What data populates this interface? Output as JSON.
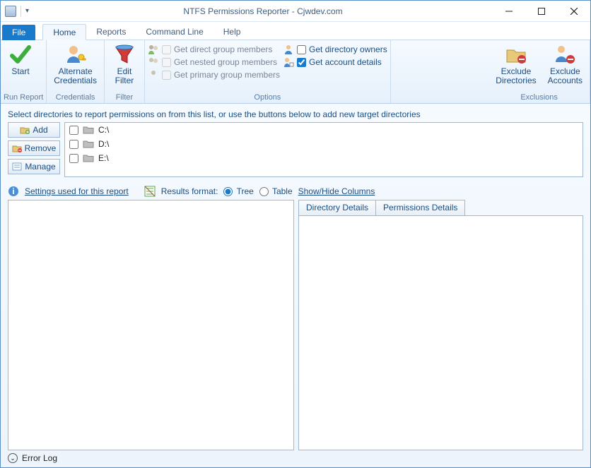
{
  "title": "NTFS Permissions Reporter - Cjwdev.com",
  "tabs": {
    "file": "File",
    "home": "Home",
    "reports": "Reports",
    "cmdline": "Command Line",
    "help": "Help"
  },
  "ribbon": {
    "runreport": {
      "start": "Start",
      "label": "Run Report"
    },
    "credentials": {
      "btn": "Alternate\nCredentials",
      "label": "Credentials"
    },
    "filter": {
      "btn": "Edit\nFilter",
      "label": "Filter"
    },
    "options": {
      "direct": "Get direct group members",
      "nested": "Get nested group members",
      "primary": "Get primary group members",
      "owners": "Get directory owners",
      "account": "Get account details",
      "label": "Options"
    },
    "exclusions": {
      "dirs": "Exclude\nDirectories",
      "accts": "Exclude\nAccounts",
      "label": "Exclusions"
    }
  },
  "instruction": "Select directories to report permissions on from this list, or use the buttons below to add new target directories",
  "dirbtns": {
    "add": "Add",
    "remove": "Remove",
    "manage": "Manage"
  },
  "drives": [
    "C:\\",
    "D:\\",
    "E:\\"
  ],
  "settings_link": "Settings used for this report",
  "results_format": "Results format:",
  "rf_tree": "Tree",
  "rf_table": "Table",
  "show_hide": "Show/Hide Columns",
  "dtab1": "Directory Details",
  "dtab2": "Permissions Details",
  "errorlog": "Error Log"
}
